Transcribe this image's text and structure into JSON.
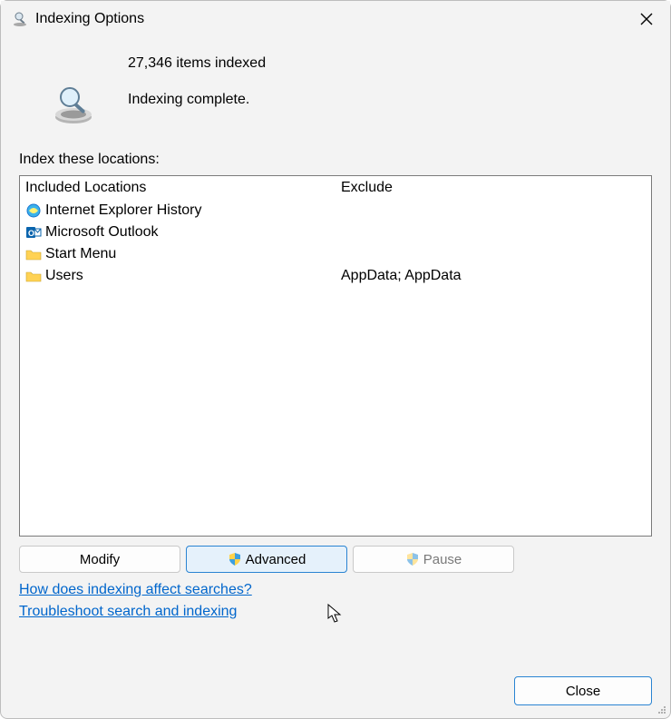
{
  "title": "Indexing Options",
  "header": {
    "count_text": "27,346 items indexed",
    "status_text": "Indexing complete."
  },
  "section_label": "Index these locations:",
  "columns": {
    "included_header": "Included Locations",
    "exclude_header": "Exclude"
  },
  "locations": [
    {
      "icon": "ie",
      "name": "Internet Explorer History",
      "exclude": ""
    },
    {
      "icon": "outlook",
      "name": "Microsoft Outlook",
      "exclude": ""
    },
    {
      "icon": "folder",
      "name": "Start Menu",
      "exclude": ""
    },
    {
      "icon": "folder",
      "name": "Users",
      "exclude": "AppData; AppData"
    }
  ],
  "buttons": {
    "modify": "Modify",
    "advanced": "Advanced",
    "pause": "Pause",
    "close": "Close"
  },
  "links": {
    "help": "How does indexing affect searches?",
    "troubleshoot": "Troubleshoot search and indexing"
  }
}
